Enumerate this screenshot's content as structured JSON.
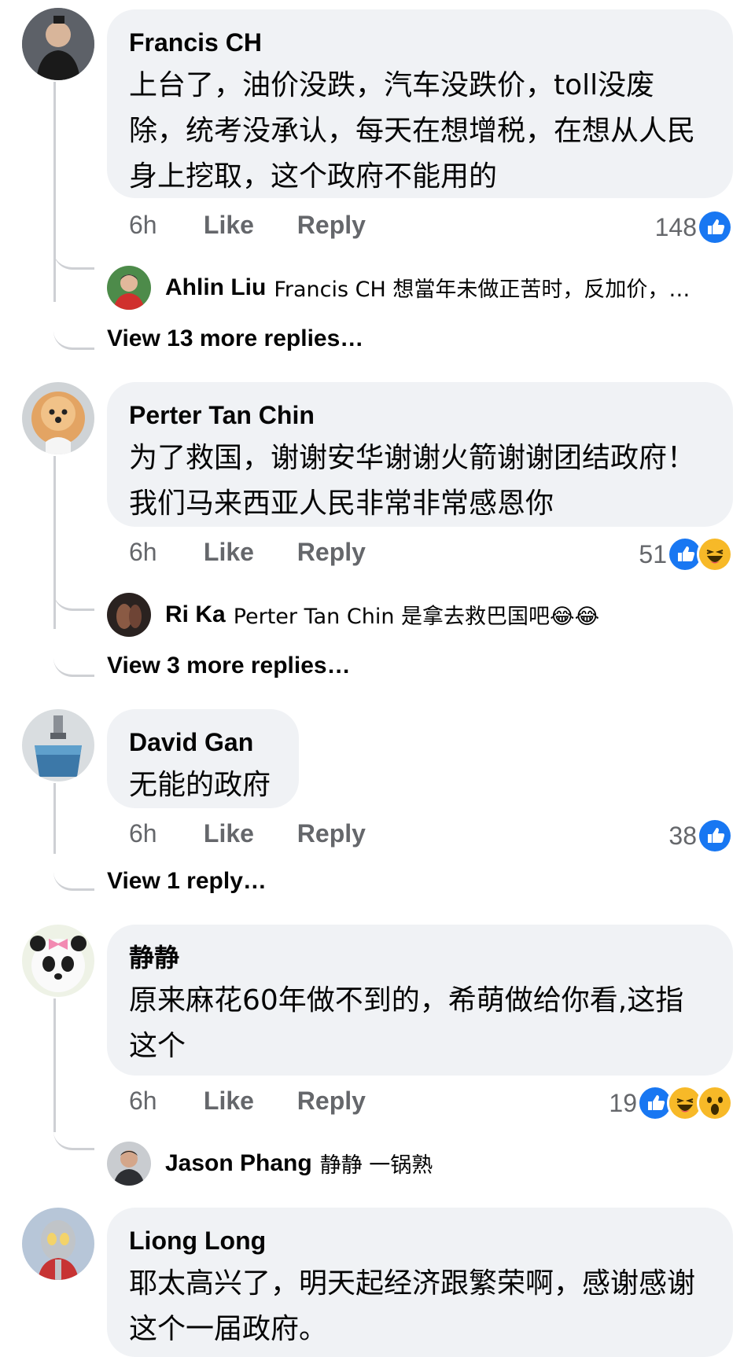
{
  "comments": [
    {
      "name": "Francis CH",
      "text": "上台了，油价没跌，汽车没跌价，toll没废除，统考没承认，每天在想增税，在想从人民身上挖取，这个政府不能用的",
      "time": "6h",
      "like": "Like",
      "reply": "Reply",
      "count": "148",
      "reactions": [
        "like-icon"
      ],
      "replies": [
        {
          "name": "Ahlin Liu",
          "text": "Francis CH 想當年未做正苦时，反加价，…"
        }
      ],
      "view_more": "View 13 more replies…"
    },
    {
      "name": "Perter Tan Chin",
      "text": "为了救国，谢谢安华谢谢火箭谢谢团结政府！我们马来西亚人民非常非常感恩你",
      "time": "6h",
      "like": "Like",
      "reply": "Reply",
      "count": "51",
      "reactions": [
        "like-icon",
        "haha-icon"
      ],
      "replies": [
        {
          "name": "Ri Ka",
          "text": "Perter Tan Chin 是拿去救巴国吧😂😂"
        }
      ],
      "view_more": "View 3 more replies…"
    },
    {
      "name": "David Gan",
      "text": "无能的政府",
      "time": "6h",
      "like": "Like",
      "reply": "Reply",
      "count": "38",
      "reactions": [
        "like-icon"
      ],
      "view_more": "View 1 reply…"
    },
    {
      "name": "静静",
      "text": "原来麻花60年做不到的，希萌做给你看,这指这个",
      "time": "6h",
      "like": "Like",
      "reply": "Reply",
      "count": "19",
      "reactions": [
        "like-icon",
        "haha-icon",
        "wow-icon"
      ],
      "replies": [
        {
          "name": "Jason Phang",
          "text": "静静 一锅熟"
        }
      ]
    },
    {
      "name": "Liong Long",
      "text": "耶太高兴了，明天起经济跟繁荣啊，感谢感谢这个一届政府。"
    }
  ],
  "colors": {
    "bubble": "#f0f2f5",
    "like_blue": "#1877f2",
    "secondary_text": "#65676b",
    "thread_line": "#ced0d4"
  }
}
